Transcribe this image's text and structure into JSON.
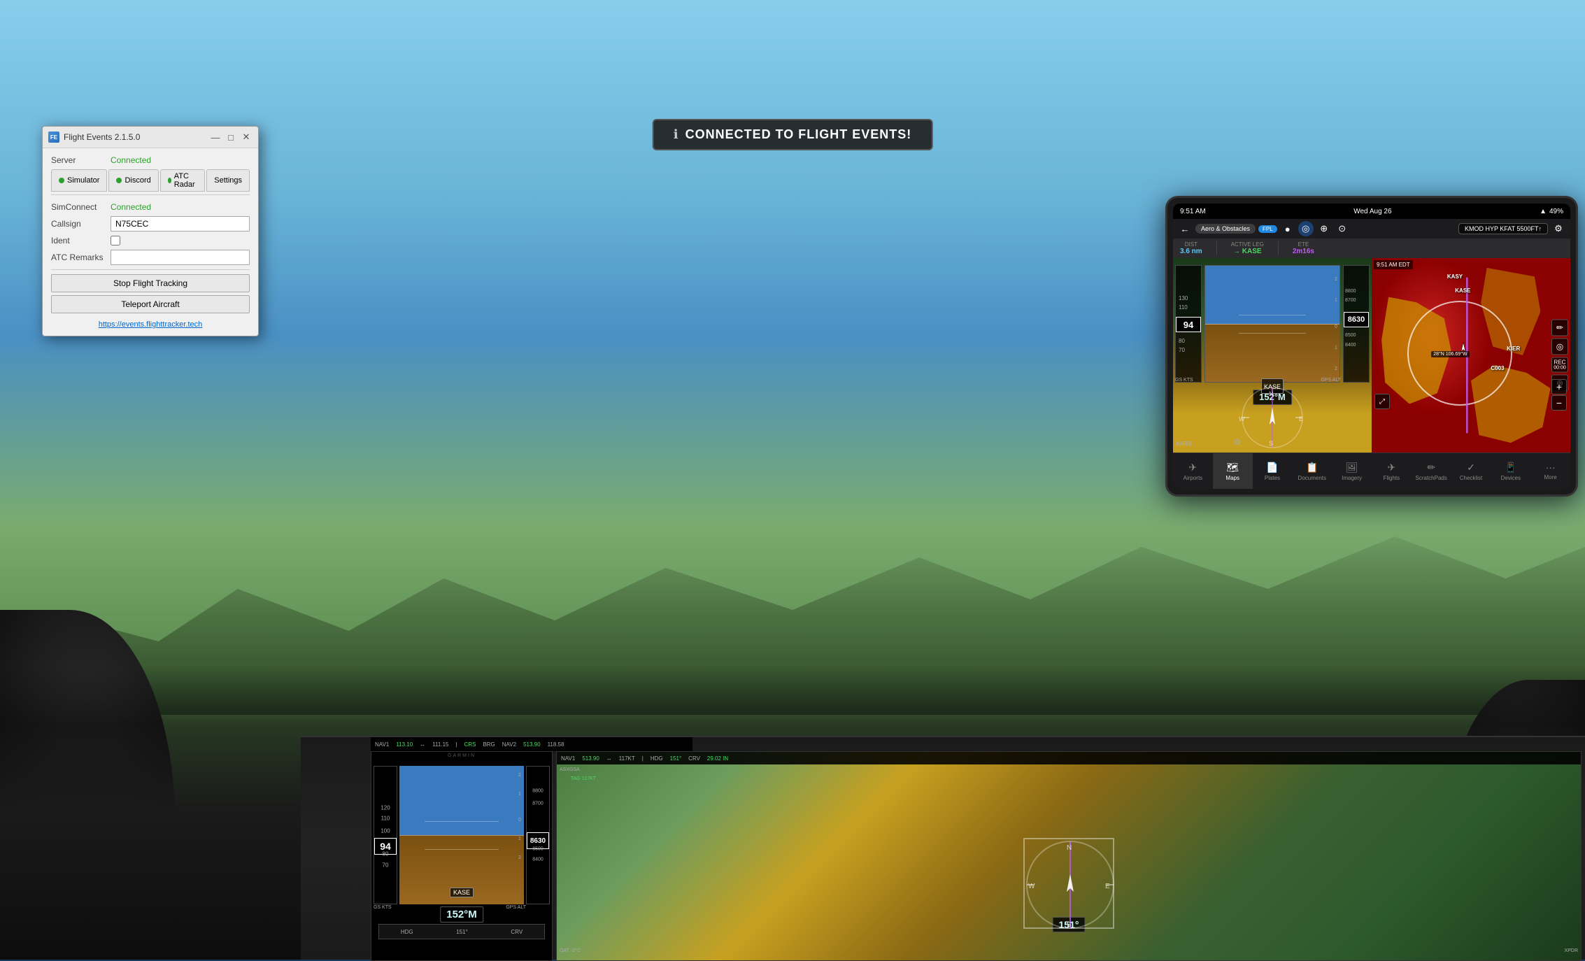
{
  "background": {
    "type": "flight_simulator_cockpit"
  },
  "connected_banner": {
    "icon": "ℹ",
    "text": "CONNECTED TO FLIGHT EVENTS!",
    "colors": {
      "bg": "#1e1e1e",
      "border": "#555",
      "text": "#ffffff"
    }
  },
  "dialog": {
    "title": "Flight Events 2.1.5.0",
    "icon": "FE",
    "window_controls": {
      "minimize": "—",
      "maximize": "□",
      "close": "✕"
    },
    "server_label": "Server",
    "server_value": "Connected",
    "tabs": [
      {
        "label": "Simulator",
        "dot": true,
        "active": false
      },
      {
        "label": "Discord",
        "dot": true,
        "active": false
      },
      {
        "label": "ATC Radar",
        "dot": true,
        "active": false
      },
      {
        "label": "Settings",
        "active": false
      }
    ],
    "simconnect_label": "SimConnect",
    "simconnect_value": "Connected",
    "callsign_label": "Callsign",
    "callsign_value": "N75CEC",
    "ident_label": "Ident",
    "atc_remarks_label": "ATC Remarks",
    "stop_flight_tracking": "Stop Flight Tracking",
    "teleport_aircraft": "Teleport Aircraft",
    "link_text": "https://events.flighttracker.tech",
    "link_url": "https://events.flighttracker.tech"
  },
  "ipad": {
    "status_bar": {
      "time": "9:51 AM",
      "date": "Wed Aug 26",
      "wifi_icon": "▲",
      "battery": "49%"
    },
    "top_bar": {
      "route_btn": "←",
      "route_text": "KMOD HYP KFAT 5500FT↑",
      "settings_icon": "⚙"
    },
    "info_strip": {
      "dist_label": "DIST",
      "dist_value": "3.6 nm",
      "active_leg_label": "ACTIVE LEG",
      "active_leg_value": "→ KASE",
      "ete_label": "ETE",
      "ete_value": "2m16s"
    },
    "map_controls": {
      "layers_btn": "Aero & Obstacles",
      "fpl_btn": "FPL",
      "icons": [
        "●",
        "◎",
        "⊕",
        "⊙"
      ]
    },
    "map": {
      "time_display": "9:51 AM EDT",
      "waypoints": [
        "KASY",
        "KASE",
        "C003",
        "KIER"
      ],
      "kase_label": "KASE",
      "course": "152°M",
      "aircraft_symbol": "✈"
    },
    "toolbar_left": {
      "layers_icon": "≡",
      "location_icon": "◎",
      "rec_label": "REC",
      "rec_time": "00:00",
      "track_icon": "⊕"
    },
    "zoom_controls": {
      "plus": "+",
      "minus": "−"
    },
    "bottom_nav": [
      {
        "label": "Airports",
        "icon": "✈",
        "active": false
      },
      {
        "label": "Maps",
        "icon": "🗺",
        "active": true
      },
      {
        "label": "Plates",
        "icon": "📄",
        "active": false
      },
      {
        "label": "Documents",
        "icon": "📋",
        "active": false
      },
      {
        "label": "Imagery",
        "icon": "🖼",
        "active": false
      },
      {
        "label": "Flights",
        "icon": "✈",
        "active": false
      },
      {
        "label": "ScratchPads",
        "icon": "✏",
        "active": false
      },
      {
        "label": "Checklist",
        "icon": "✓",
        "active": false
      },
      {
        "label": "Devices",
        "icon": "📱",
        "active": false
      },
      {
        "label": "More",
        "icon": "•••",
        "active": false
      }
    ]
  },
  "instruments": {
    "garmin_label": "GARMIN",
    "nav1_freq": "113.10",
    "nav1_stby": "111.15",
    "nav2_freq": "513.90",
    "nav2_stby": "118.58",
    "ias": "94",
    "alt": "8630",
    "hdg": "151°",
    "crs": "CRS",
    "gs_kts": "GS KTS",
    "gps_alt": "GPS ALT",
    "speed_label": "152°M"
  },
  "colors": {
    "accent_green": "#2ea02e",
    "accent_blue": "#0066cc",
    "connected_green": "#2ea02e",
    "dialog_bg": "#f0f0f0",
    "ipad_bg": "#1a1a1a",
    "terrain_red": "#cc2222",
    "terrain_yellow": "#cc9900",
    "sky_blue": "#87ceeb"
  }
}
